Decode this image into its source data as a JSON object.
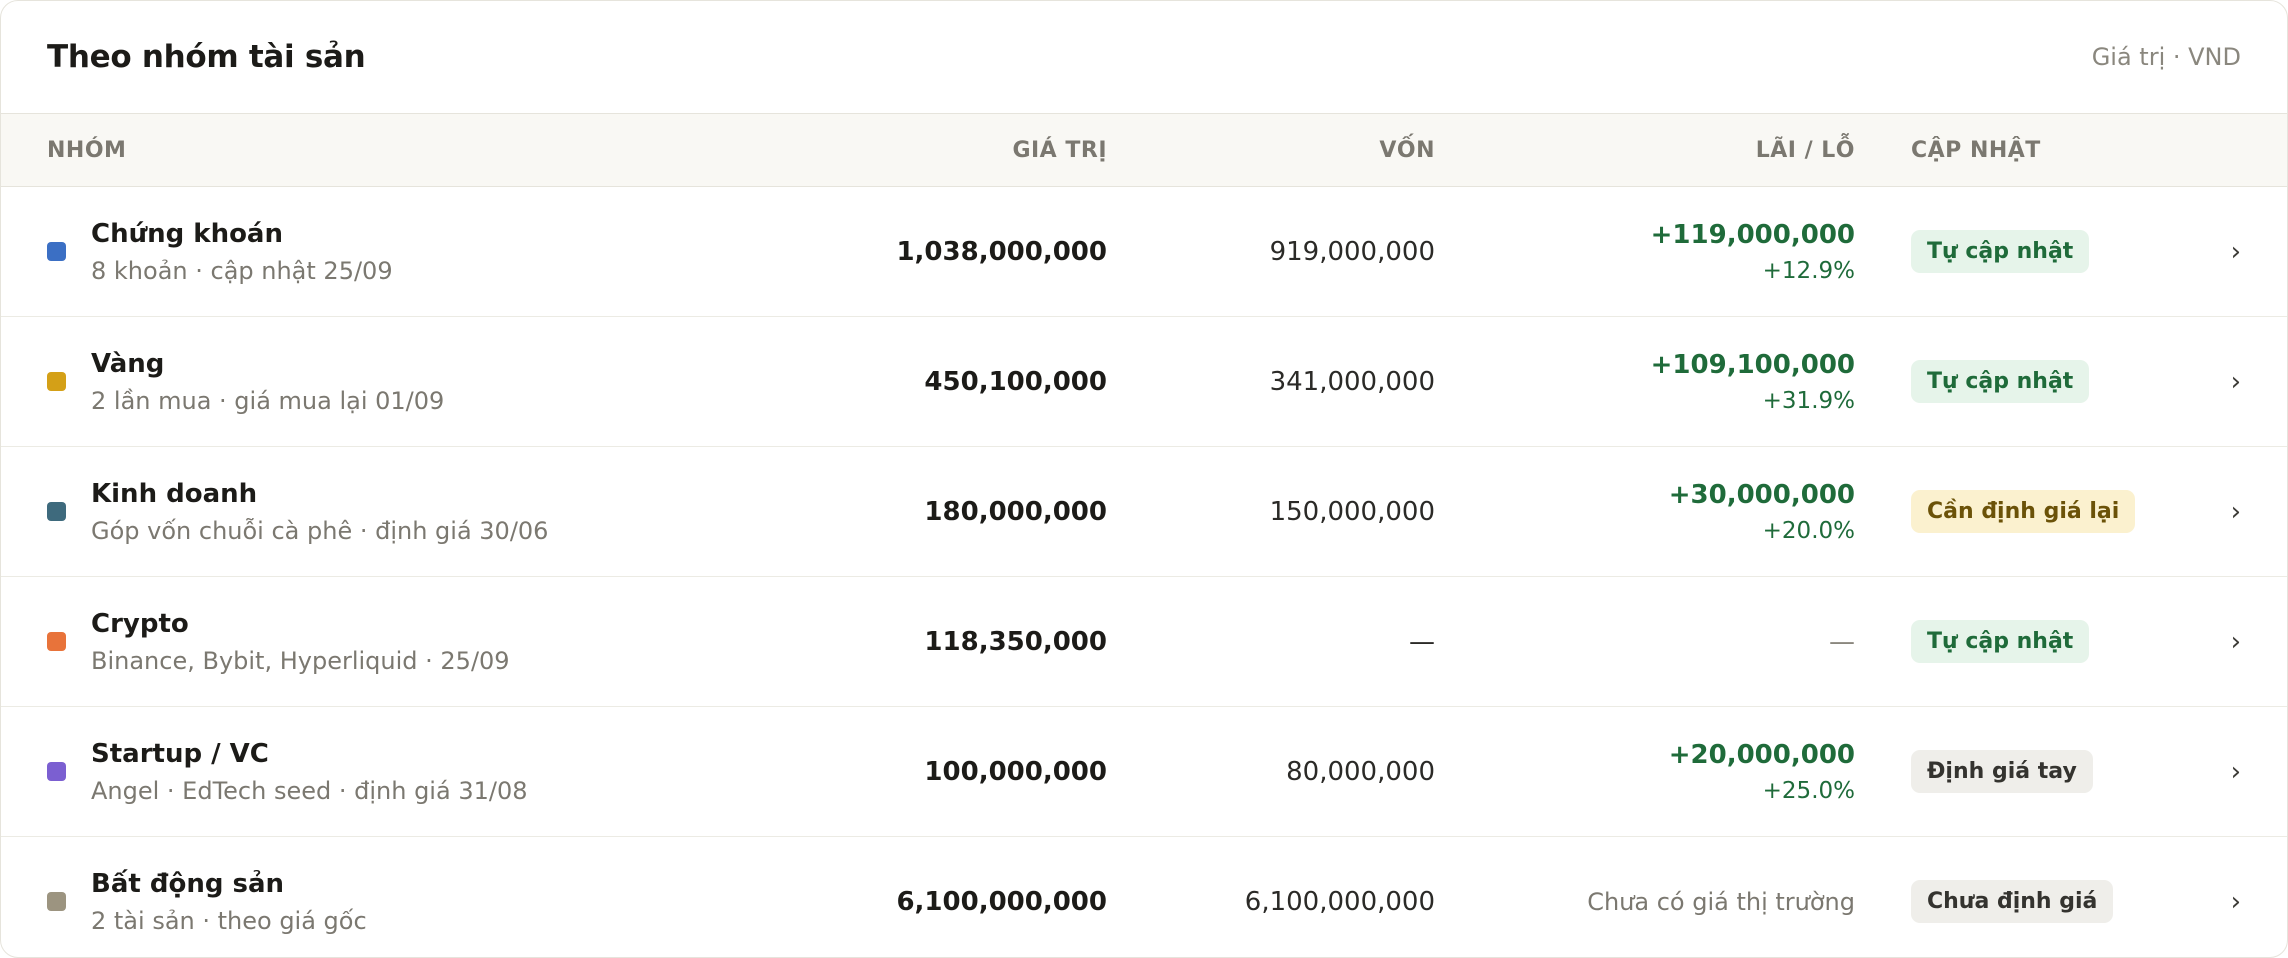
{
  "header": {
    "title": "Theo nhóm tài sản",
    "unit": "Giá trị · VND"
  },
  "columns": {
    "group": "NHÓM",
    "value": "GIÁ TRỊ",
    "capital": "VỐN",
    "pl": "LÃI / LỖ",
    "status": "CẬP NHẬT"
  },
  "chevron": "›",
  "rows": [
    {
      "name": "Chứng khoán",
      "sub": "8 khoản · cập nhật 25/09",
      "color": "#3b6fc4",
      "value": "1,038,000,000",
      "capital": "919,000,000",
      "pl_amount": "+119,000,000",
      "pl_pct": "+12.9%",
      "status": "Tự cập nhật"
    },
    {
      "name": "Vàng",
      "sub": "2 lần mua · giá mua lại 01/09",
      "color": "#d4a017",
      "value": "450,100,000",
      "capital": "341,000,000",
      "pl_amount": "+109,100,000",
      "pl_pct": "+31.9%",
      "status": "Tự cập nhật"
    },
    {
      "name": "Kinh doanh",
      "sub": "Góp vốn chuỗi cà phê · định giá 30/06",
      "color": "#3e6a7d",
      "value": "180,000,000",
      "capital": "150,000,000",
      "pl_amount": "+30,000,000",
      "pl_pct": "+20.0%",
      "status": "Cần định giá lại"
    },
    {
      "name": "Crypto",
      "sub": "Binance, Bybit, Hyperliquid · 25/09",
      "color": "#e8733a",
      "value": "118,350,000",
      "capital": "—",
      "pl_dash": "—",
      "status": "Tự cập nhật"
    },
    {
      "name": "Startup / VC",
      "sub": "Angel · EdTech seed · định giá 31/08",
      "color": "#7b5fd1",
      "value": "100,000,000",
      "capital": "80,000,000",
      "pl_amount": "+20,000,000",
      "pl_pct": "+25.0%",
      "status": "Định giá tay"
    },
    {
      "name": "Bất động sản",
      "sub": "2 tài sản · theo giá gốc",
      "color": "#9c9480",
      "value": "6,100,000,000",
      "capital": "6,100,000,000",
      "pl_note": "Chưa có giá thị trường",
      "status": "Chưa định giá"
    }
  ]
}
